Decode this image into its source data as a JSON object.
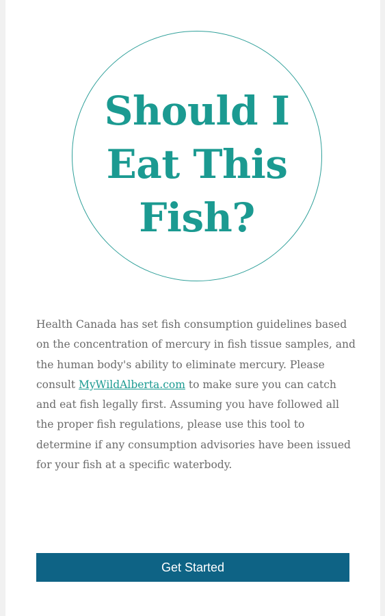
{
  "title": "Should I Eat This Fish?",
  "intro": {
    "before_link": "Health Canada has set fish consumption guidelines based on the concentration of mercury in fish tissue samples, and the human body's ability to eliminate mercury. Please consult ",
    "link_text": "MyWildAlberta.com",
    "after_link": " to make sure you can catch and eat fish legally first. Assuming you have followed all the proper fish regulations, please use this tool to determine if any consumption advisories have been issued for your fish at a specific waterbody."
  },
  "cta_label": "Get Started",
  "colors": {
    "accent": "#1b9a91",
    "button": "#0e6385",
    "body_text": "#6b6b6b",
    "background": "#f1f1f1",
    "card": "#ffffff"
  }
}
